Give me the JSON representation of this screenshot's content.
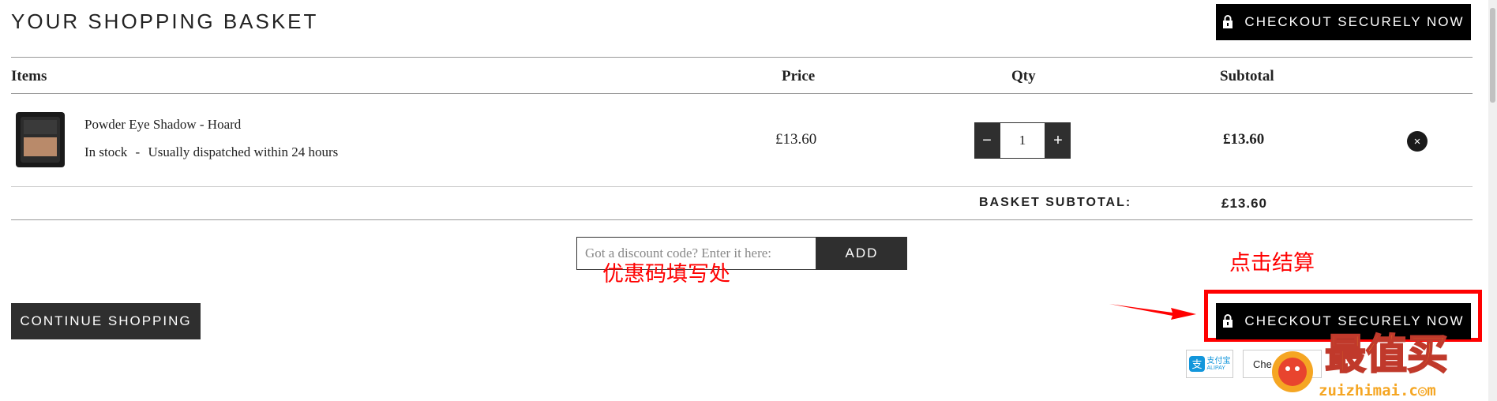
{
  "header": {
    "title": "YOUR SHOPPING BASKET",
    "checkout_label": "CHECKOUT SECURELY NOW"
  },
  "table": {
    "columns": [
      "Items",
      "Price",
      "Qty",
      "Subtotal"
    ],
    "rows": [
      {
        "name": "Powder Eye Shadow - Hoard",
        "stock": "In stock",
        "separator": "-",
        "dispatch": "Usually dispatched within 24 hours",
        "price": "£13.60",
        "qty": "1",
        "subtotal": "£13.60"
      }
    ],
    "minus": "−",
    "plus": "+",
    "remove": "×"
  },
  "summary": {
    "label": "BASKET SUBTOTAL:",
    "value": "£13.60"
  },
  "discount": {
    "placeholder": "Got a discount code? Enter it here:",
    "add_label": "ADD"
  },
  "annotations": {
    "discount_hint": "优惠码填写处",
    "checkout_hint": "点击结算"
  },
  "footer": {
    "continue_label": "CONTINUE SHOPPING",
    "checkout_label": "CHECKOUT SECURELY NOW"
  },
  "payments": {
    "alipay_cn": "支付宝",
    "alipay_en": "ALIPAY",
    "checkout_partial": "Che"
  },
  "watermark": {
    "cn": "最值买",
    "url": "zuizhimai.c◎m"
  },
  "colors": {
    "primary": "#000000",
    "secondary": "#2f2f2f",
    "annotation": "#ff0000"
  }
}
